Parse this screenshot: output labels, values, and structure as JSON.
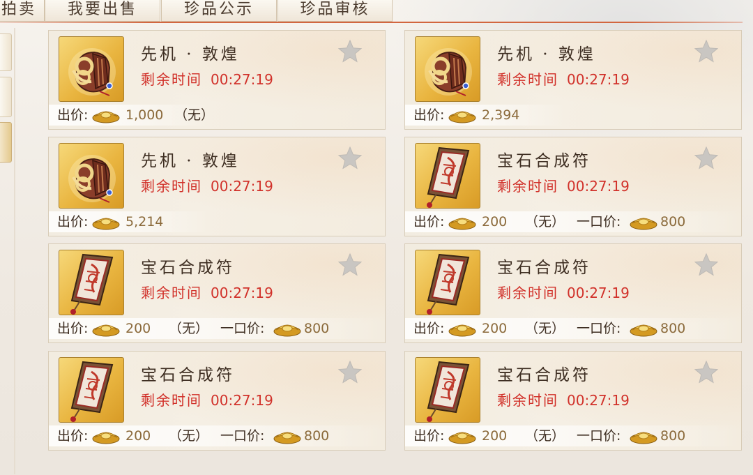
{
  "tabs": [
    {
      "label": "拍卖"
    },
    {
      "label": "我要出售"
    },
    {
      "label": "珍品公示"
    },
    {
      "label": "珍品审核"
    }
  ],
  "labels": {
    "timer": "剩余时间",
    "bid": "出价:",
    "buyout": "一口价:"
  },
  "items": [
    {
      "name": "先机 · 敦煌",
      "type": "bag",
      "time": "00:27:19",
      "bid": "1,000",
      "bid_note": "（无）",
      "buyout": ""
    },
    {
      "name": "先机 · 敦煌",
      "type": "bag",
      "time": "00:27:19",
      "bid": "2,394",
      "bid_note": "",
      "buyout": ""
    },
    {
      "name": "先机 · 敦煌",
      "type": "bag",
      "time": "00:27:19",
      "bid": "5,214",
      "bid_note": "",
      "buyout": ""
    },
    {
      "name": "宝石合成符",
      "type": "talisman",
      "time": "00:27:19",
      "bid": "200",
      "bid_note": "（无）",
      "buyout": "800"
    },
    {
      "name": "宝石合成符",
      "type": "talisman",
      "time": "00:27:19",
      "bid": "200",
      "bid_note": "（无）",
      "buyout": "800"
    },
    {
      "name": "宝石合成符",
      "type": "talisman",
      "time": "00:27:19",
      "bid": "200",
      "bid_note": "（无）",
      "buyout": "800"
    },
    {
      "name": "宝石合成符",
      "type": "talisman",
      "time": "00:27:19",
      "bid": "200",
      "bid_note": "（无）",
      "buyout": "800"
    },
    {
      "name": "宝石合成符",
      "type": "talisman",
      "time": "00:27:19",
      "bid": "200",
      "bid_note": "（无）",
      "buyout": "800"
    }
  ],
  "colors": {
    "timer": "#d1312a",
    "price_value": "#8b6a3b",
    "accent_line": "#d2663f",
    "gold": "#e9b540"
  }
}
